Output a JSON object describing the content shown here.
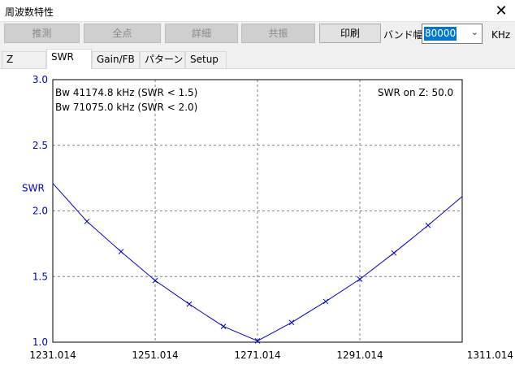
{
  "window": {
    "title": "周波数特性",
    "close_glyph": "✕"
  },
  "toolbar": {
    "buttons": [
      {
        "label": "推測",
        "enabled": false
      },
      {
        "label": "全点",
        "enabled": false
      },
      {
        "label": "詳細",
        "enabled": false
      },
      {
        "label": "共振",
        "enabled": false
      },
      {
        "label": "印刷",
        "enabled": true
      }
    ],
    "band_label": "バンド幅",
    "band_value": "80000",
    "unit": "KHz"
  },
  "tabs": [
    {
      "label": "Z",
      "active": false
    },
    {
      "label": "SWR",
      "active": true
    },
    {
      "label": "Gain/FB",
      "active": false
    },
    {
      "label": "パターン",
      "active": false
    },
    {
      "label": "Setup",
      "active": false
    }
  ],
  "info": {
    "bw1": "Bw 41174.8 kHz (SWR < 1.5)",
    "bw2": "Bw 71075.0 kHz (SWR < 2.0)",
    "swr_on_z": "SWR on Z: 50.0"
  },
  "chart_data": {
    "type": "line",
    "ylabel": "SWR",
    "xlim": [
      1231.014,
      1311.014
    ],
    "ylim": [
      1.0,
      3.0
    ],
    "x_ticks": [
      "1231.014",
      "1251.014",
      "1271.014",
      "1291.014",
      "1311.014"
    ],
    "y_ticks": [
      "3.0",
      "2.5",
      "2.0",
      "1.5",
      "1.0"
    ],
    "grid": true,
    "series": [
      {
        "color": "#0000cc",
        "x": [
          1231.014,
          1237.68,
          1244.35,
          1251.014,
          1257.68,
          1264.35,
          1271.014,
          1277.68,
          1284.35,
          1291.014,
          1297.68,
          1304.35,
          1311.014
        ],
        "y": [
          2.21,
          1.92,
          1.69,
          1.47,
          1.29,
          1.12,
          1.01,
          1.15,
          1.31,
          1.48,
          1.68,
          1.89,
          2.11
        ]
      }
    ]
  }
}
